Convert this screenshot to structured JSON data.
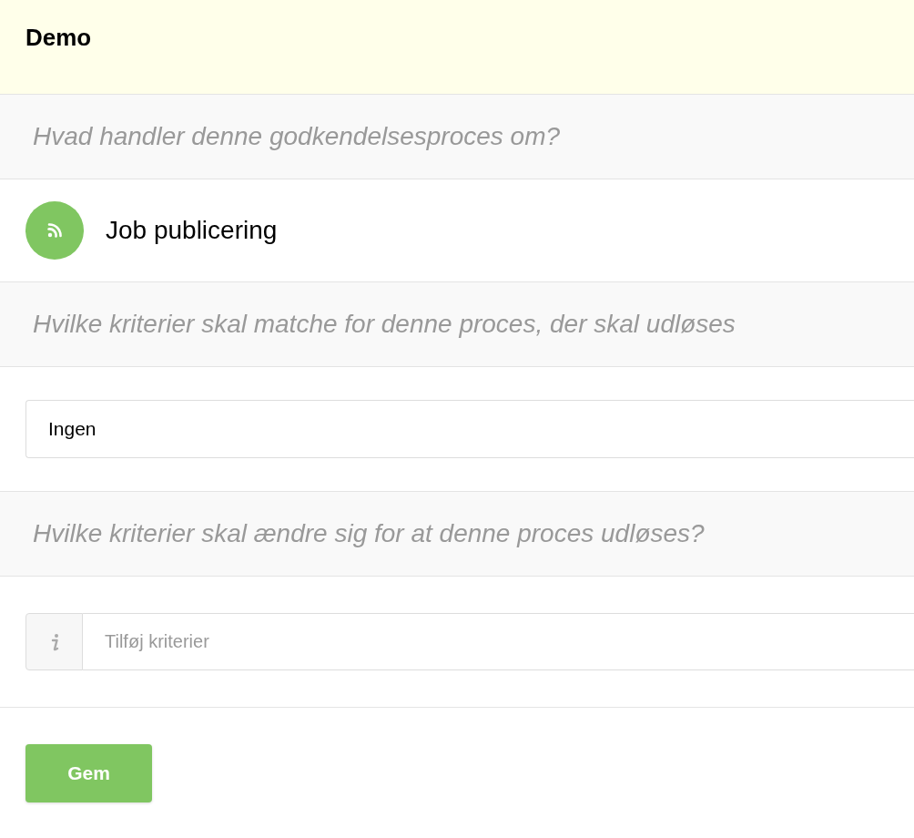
{
  "header": {
    "title": "Demo"
  },
  "sections": [
    {
      "kind": "question",
      "text": "Hvad handler denne godkendelsesproces om?"
    },
    {
      "kind": "process",
      "label": "Job publicering"
    },
    {
      "kind": "question",
      "text": "Hvilke kriterier skal matche for denne proces, der skal udløses"
    },
    {
      "kind": "select",
      "value": "Ingen"
    },
    {
      "kind": "question",
      "text": "Hvilke kriterier skal ændre sig for at denne proces udløses?"
    },
    {
      "kind": "input",
      "placeholder": "Tilføj kriterier"
    }
  ],
  "buttons": [
    {
      "label": "Gem"
    }
  ]
}
